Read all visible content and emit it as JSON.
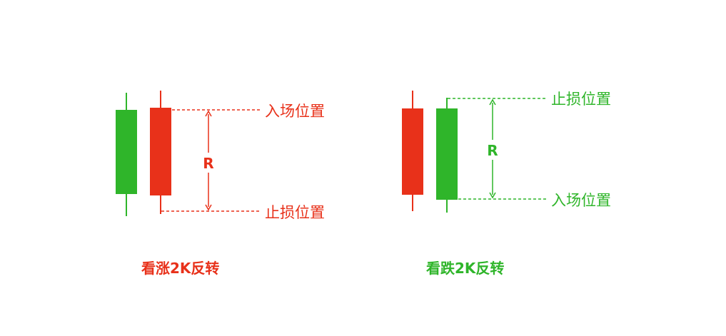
{
  "colors": {
    "red": "#e8311a",
    "green": "#2fb52a",
    "white": "#ffffff"
  },
  "panels": [
    {
      "id": "bullish",
      "caption": "看涨2K反转",
      "accent": "red",
      "candles": [
        {
          "color": "green",
          "role": "bar-1"
        },
        {
          "color": "red",
          "role": "bar-2"
        }
      ],
      "top_label": "入场位置",
      "bottom_label": "止损位置",
      "r_label": "R"
    },
    {
      "id": "bearish",
      "caption": "看跌2K反转",
      "accent": "green",
      "candles": [
        {
          "color": "red",
          "role": "bar-1"
        },
        {
          "color": "green",
          "role": "bar-2"
        }
      ],
      "top_label": "止损位置",
      "bottom_label": "入场位置",
      "r_label": "R"
    }
  ]
}
